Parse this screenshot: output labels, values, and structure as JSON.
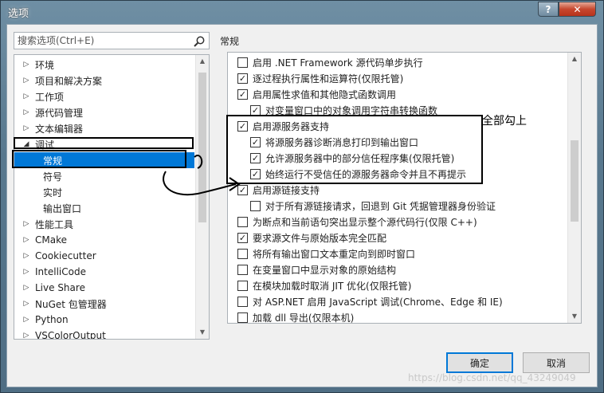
{
  "window": {
    "title": "选项",
    "help_glyph": "?",
    "close_glyph": "✕"
  },
  "search": {
    "placeholder": "搜索选项(Ctrl+E)"
  },
  "tree": {
    "items": [
      {
        "label": "环境",
        "arrow": "▷"
      },
      {
        "label": "项目和解决方案",
        "arrow": "▷"
      },
      {
        "label": "工作项",
        "arrow": "▷"
      },
      {
        "label": "源代码管理",
        "arrow": "▷"
      },
      {
        "label": "文本编辑器",
        "arrow": "▷"
      },
      {
        "label": "调试",
        "arrow": "◢"
      },
      {
        "label": "常规",
        "arrow": ""
      },
      {
        "label": "符号",
        "arrow": ""
      },
      {
        "label": "实时",
        "arrow": ""
      },
      {
        "label": "输出窗口",
        "arrow": ""
      },
      {
        "label": "性能工具",
        "arrow": "▷"
      },
      {
        "label": "CMake",
        "arrow": "▷"
      },
      {
        "label": "Cookiecutter",
        "arrow": "▷"
      },
      {
        "label": "IntelliCode",
        "arrow": "▷"
      },
      {
        "label": "Live Share",
        "arrow": "▷"
      },
      {
        "label": "NuGet 包管理器",
        "arrow": "▷"
      },
      {
        "label": "Python",
        "arrow": "▷"
      },
      {
        "label": "VSColorOutput",
        "arrow": "▷"
      }
    ],
    "selected": "常规"
  },
  "section": {
    "label": "常规"
  },
  "options": [
    {
      "label": "启用 .NET Framework 源代码单步执行",
      "checked": false,
      "mark": ""
    },
    {
      "label": "逐过程执行属性和运算符(仅限托管)",
      "checked": true,
      "mark": "✓"
    },
    {
      "label": "启用属性求值和其他隐式函数调用",
      "checked": true,
      "mark": "✓"
    },
    {
      "label": "对变量窗口中的对象调用字符串转换函数",
      "checked": true,
      "mark": "✓"
    },
    {
      "label": "启用源服务器支持",
      "checked": true,
      "mark": "✓"
    },
    {
      "label": "将源服务器诊断消息打印到输出窗口",
      "checked": true,
      "mark": "✓"
    },
    {
      "label": "允许源服务器中的部分信任程序集(仅限托管)",
      "checked": true,
      "mark": "✓"
    },
    {
      "label": "始终运行不受信任的源服务器命令并且不再提示",
      "checked": true,
      "mark": "✓"
    },
    {
      "label": "启用源链接支持",
      "checked": true,
      "mark": "✓"
    },
    {
      "label": "对于所有源链接请求，回退到 Git 凭据管理器身份验证",
      "checked": false,
      "mark": ""
    },
    {
      "label": "为断点和当前语句突出显示整个源代码行(仅限 C++)",
      "checked": false,
      "mark": ""
    },
    {
      "label": "要求源文件与原始版本完全匹配",
      "checked": true,
      "mark": "✓"
    },
    {
      "label": "将所有输出窗口文本重定向到即时窗口",
      "checked": false,
      "mark": ""
    },
    {
      "label": "在变量窗口中显示对象的原始结构",
      "checked": false,
      "mark": ""
    },
    {
      "label": "在模块加载时取消 JIT 优化(仅限托管)",
      "checked": false,
      "mark": ""
    },
    {
      "label": "对 ASP.NET 启用 JavaScript 调试(Chrome、Edge 和 IE)",
      "checked": false,
      "mark": ""
    },
    {
      "label": "加载 dll 导出(仅限本机)",
      "checked": false,
      "mark": ""
    }
  ],
  "annotation": {
    "text": "全部勾上"
  },
  "buttons": {
    "ok": "确定",
    "cancel": "取消"
  },
  "watermark": "https://blog.csdn.net/qq_43249049"
}
